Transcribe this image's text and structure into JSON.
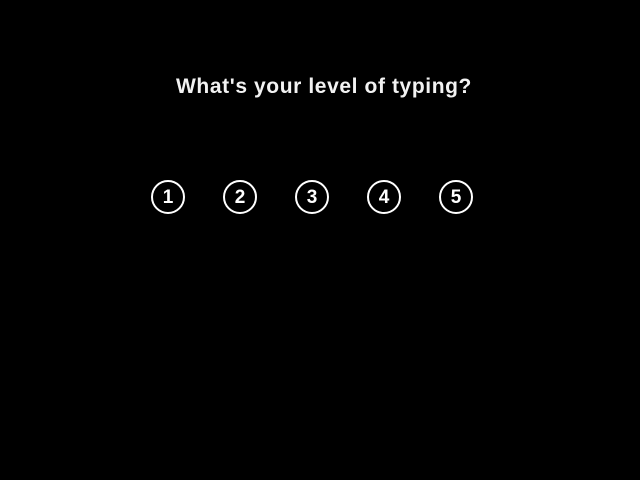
{
  "survey": {
    "question": "What's your level of typing?",
    "options": [
      {
        "label": "1"
      },
      {
        "label": "2"
      },
      {
        "label": "3"
      },
      {
        "label": "4"
      },
      {
        "label": "5"
      }
    ]
  },
  "colors": {
    "background": "#000000",
    "text": "#ffffff"
  }
}
